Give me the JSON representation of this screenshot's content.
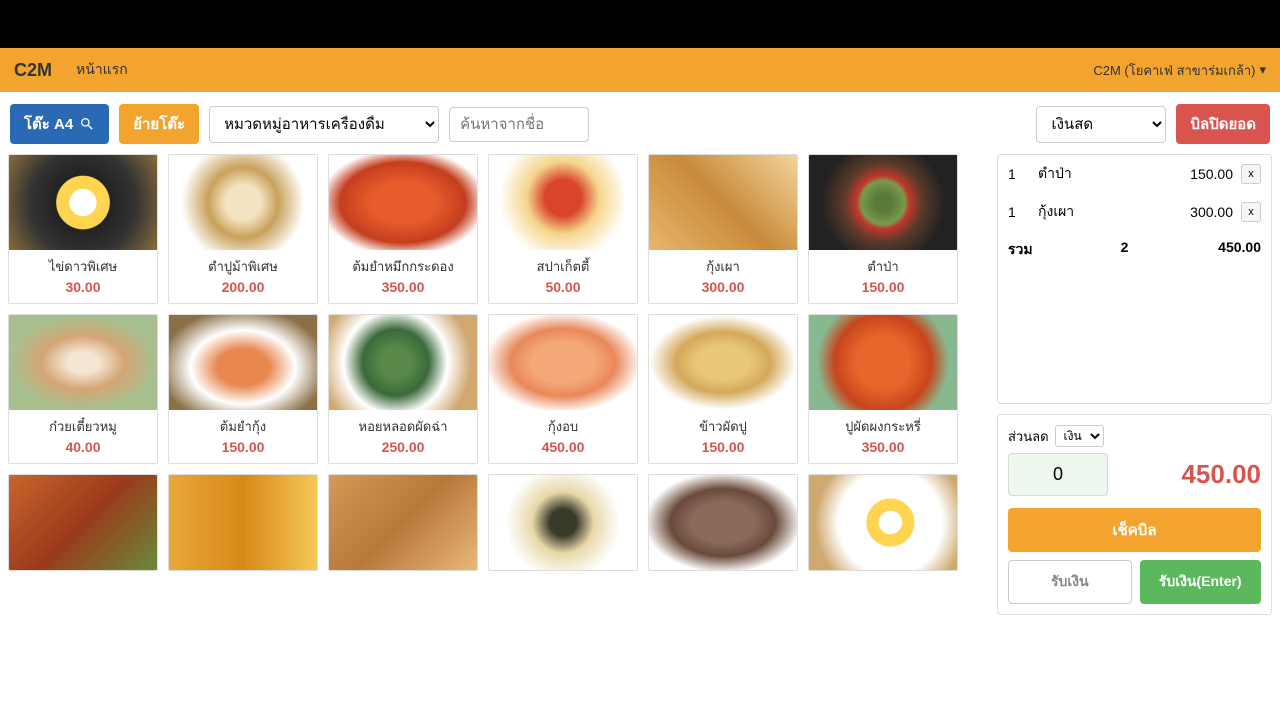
{
  "header": {
    "brand": "C2M",
    "home": "หน้าแรก",
    "branch": "C2M (โยคาเฟ่ สาขาร่มเกล้า)"
  },
  "controls": {
    "table_btn": "โต๊ะ A4",
    "move_table_btn": "ย้ายโต๊ะ",
    "category_sel": "หมวดหมู่อาหารเครื่องดื่ม",
    "search_placeholder": "ค้นหาจากชื่อ",
    "payment_sel": "เงินสด",
    "close_bill_btn": "บิลปิดยอด"
  },
  "menu": [
    {
      "name": "ไข่ดาวพิเศษ",
      "price": "30.00",
      "img": "f0"
    },
    {
      "name": "ตำปูม้าพิเศษ",
      "price": "200.00",
      "img": "f1"
    },
    {
      "name": "ต้มยำหมึกกระดอง",
      "price": "350.00",
      "img": "f2"
    },
    {
      "name": "สปาเก็ตตี้",
      "price": "50.00",
      "img": "f3"
    },
    {
      "name": "กุ้งเผา",
      "price": "300.00",
      "img": "f4"
    },
    {
      "name": "ตำป่า",
      "price": "150.00",
      "img": "f5"
    },
    {
      "name": "ก๋วยเตี๋ยวหมู",
      "price": "40.00",
      "img": "f6"
    },
    {
      "name": "ต้มยำกุ้ง",
      "price": "150.00",
      "img": "f7"
    },
    {
      "name": "หอยหลอดผัดฉ่า",
      "price": "250.00",
      "img": "f8"
    },
    {
      "name": "กุ้งอบ",
      "price": "450.00",
      "img": "f9"
    },
    {
      "name": "ข้าวผัดปู",
      "price": "150.00",
      "img": "f10"
    },
    {
      "name": "ปูผัดผงกระหรี่",
      "price": "350.00",
      "img": "f11"
    },
    {
      "name": "",
      "price": "",
      "img": "f12"
    },
    {
      "name": "",
      "price": "",
      "img": "f13"
    },
    {
      "name": "",
      "price": "",
      "img": "f14"
    },
    {
      "name": "",
      "price": "",
      "img": "f15"
    },
    {
      "name": "",
      "price": "",
      "img": "f16"
    },
    {
      "name": "",
      "price": "",
      "img": "f17"
    }
  ],
  "order": {
    "items": [
      {
        "qty": "1",
        "name": "ตำป่า",
        "price": "150.00"
      },
      {
        "qty": "1",
        "name": "กุ้งเผา",
        "price": "300.00"
      }
    ],
    "total_label": "รวม",
    "total_qty": "2",
    "total_price": "450.00"
  },
  "checkout": {
    "discount_label": "ส่วนลด",
    "discount_type": "เงิน",
    "discount_value": "0",
    "grand_total": "450.00",
    "check_bill_btn": "เช็คบิล",
    "receive_btn": "รับเงิน",
    "receive_enter_btn": "รับเงิน(Enter)"
  }
}
